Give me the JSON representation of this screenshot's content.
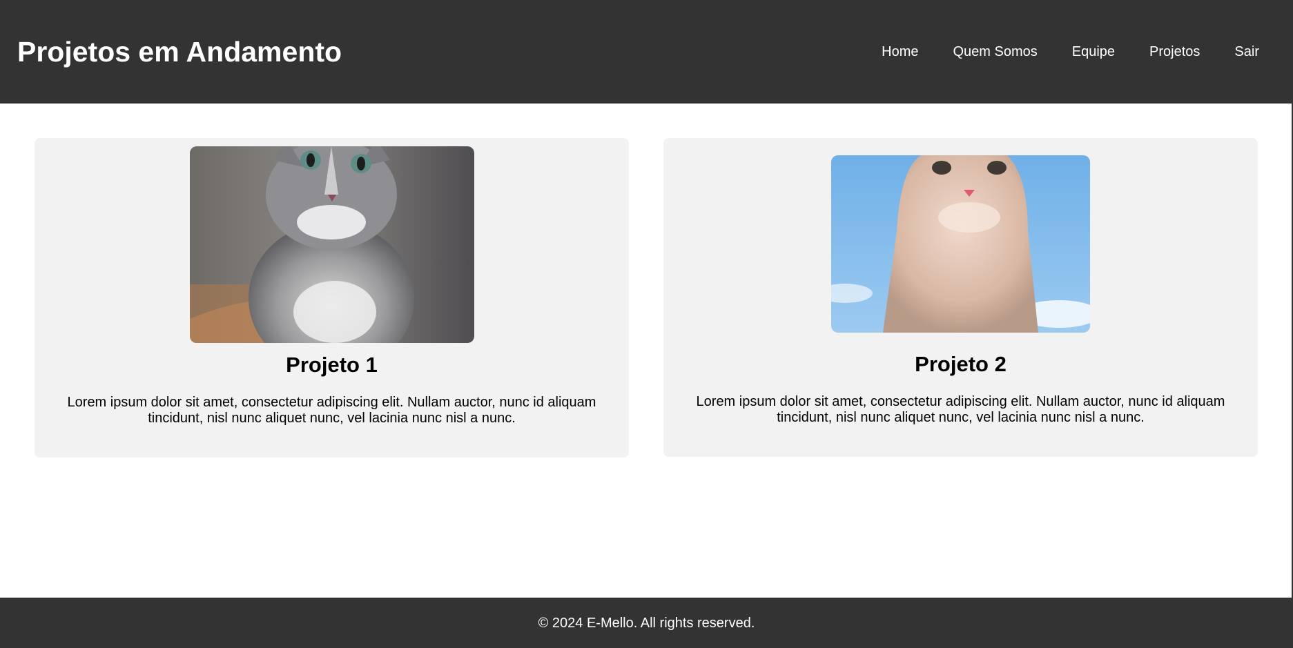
{
  "header": {
    "title": "Projetos em Andamento",
    "nav": [
      "Home",
      "Quem Somos",
      "Equipe",
      "Projetos",
      "Sair"
    ]
  },
  "projects": [
    {
      "title": "Projeto 1",
      "description": "Lorem ipsum dolor sit amet, consectetur adipiscing elit. Nullam auctor, nunc id aliquam tincidunt, nisl nunc aliquet nunc, vel lacinia nunc nisl a nunc.",
      "image": "gray-tabby-kitten-photo"
    },
    {
      "title": "Projeto 2",
      "description": "Lorem ipsum dolor sit amet, consectetur adipiscing elit. Nullam auctor, nunc id aliquam tincidunt, nisl nunc aliquet nunc, vel lacinia nunc nisl a nunc.",
      "image": "white-kitten-sky-photo"
    }
  ],
  "footer": {
    "text": "© 2024 E-Mello. All rights reserved."
  },
  "colors": {
    "bar": "#333333",
    "card": "#f2f2f2",
    "text_light": "#ffffff",
    "text_dark": "#000000"
  }
}
